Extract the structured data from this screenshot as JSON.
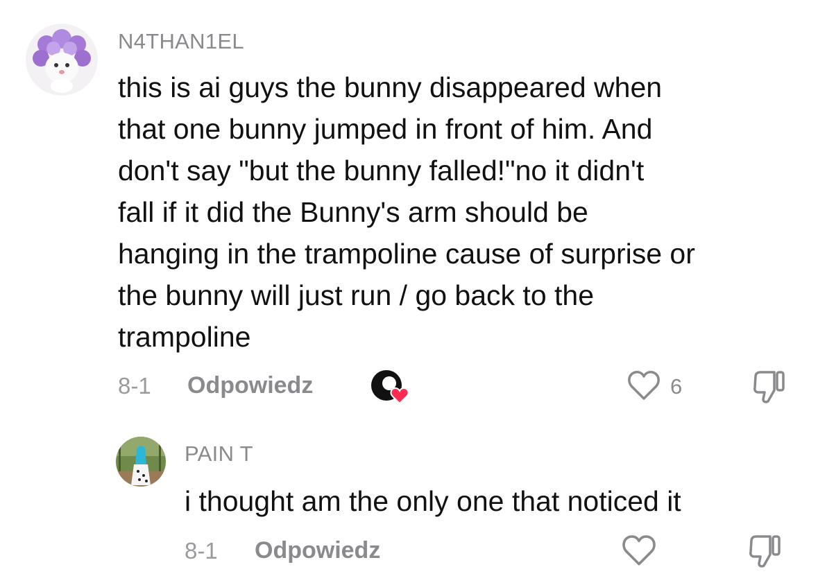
{
  "comments": [
    {
      "username": "N4THAN1EL",
      "text": "this is ai guys the bunny disappeared when\nthat one bunny jumped in front of him. And\ndon't say \"but the bunny falled!\"no it didn't\nfall if it did the Bunny's arm should be\nhanging in the trampoline cause of surprise or\nthe bunny will just run / go back to the\ntrampoline",
      "date": "8-1",
      "reply_label": "Odpowiedz",
      "like_count": "6",
      "liked_by_creator": true
    },
    {
      "username": "PAIN T",
      "text": "i thought am the only one that noticed it",
      "date": "8-1",
      "reply_label": "Odpowiedz",
      "like_count": ""
    }
  ],
  "icons": {
    "like": "heart-outline-icon",
    "dislike": "thumbs-down-icon",
    "creator_liked": "creator-liked-heart-icon"
  },
  "colors": {
    "username": "#8a8a8e",
    "text": "#111111",
    "creator_heart": "#fe2c55"
  }
}
